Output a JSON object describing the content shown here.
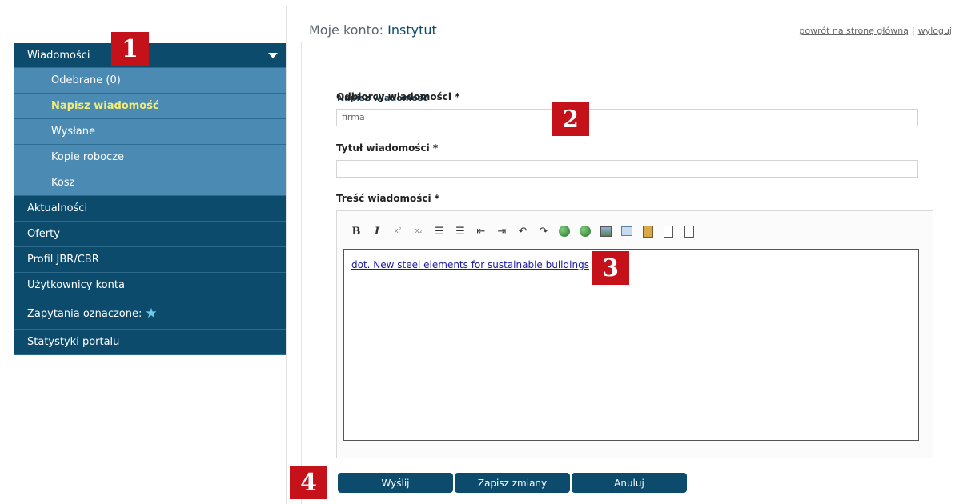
{
  "sidebar": {
    "top": {
      "label": "Wiadomości"
    },
    "sub": [
      {
        "label": "Odebrane (0)"
      },
      {
        "label": "Napisz wiadomość"
      },
      {
        "label": "Wysłane"
      },
      {
        "label": "Kopie robocze"
      },
      {
        "label": "Kosz"
      }
    ],
    "items": [
      {
        "label": "Aktualności"
      },
      {
        "label": "Oferty"
      },
      {
        "label": "Profil JBR/CBR"
      },
      {
        "label": "Użytkownicy konta"
      },
      {
        "label": "Zapytania oznaczone:"
      },
      {
        "label": "Statystyki portalu"
      }
    ]
  },
  "header": {
    "prefix": "Moje konto:",
    "name": "Instytut",
    "link_home": "powrót na stronę główną",
    "separator": "|",
    "link_logout": "wyloguj"
  },
  "form": {
    "title": "Napisz wiadomość",
    "recipients_label": "Odbiorcy wiadomości *",
    "recipients_value": "firma",
    "subject_label": "Tytuł wiadomości *",
    "subject_value": "",
    "body_label": "Treść wiadomości *",
    "body_link": "dot. New steel elements for sustainable buildings"
  },
  "toolbar": {
    "bold": "B",
    "italic": "I",
    "superscript": "x²",
    "subscript": "x₂",
    "icons": [
      "ordered-list-icon",
      "unordered-list-icon",
      "outdent-icon",
      "indent-icon",
      "undo-icon",
      "redo-icon",
      "link-icon",
      "unlink-icon",
      "image-icon",
      "table-icon",
      "paste-icon",
      "source-icon",
      "preview-icon"
    ]
  },
  "buttons": {
    "send": "Wyślij",
    "save": "Zapisz zmiany",
    "cancel": "Anuluj"
  },
  "markers": [
    "1",
    "2",
    "3",
    "4"
  ],
  "colors": {
    "nav_dark": "#0d4b6d",
    "nav_light": "#4a8ab3",
    "active_text": "#f5ee70",
    "marker_red": "#c4111a"
  }
}
